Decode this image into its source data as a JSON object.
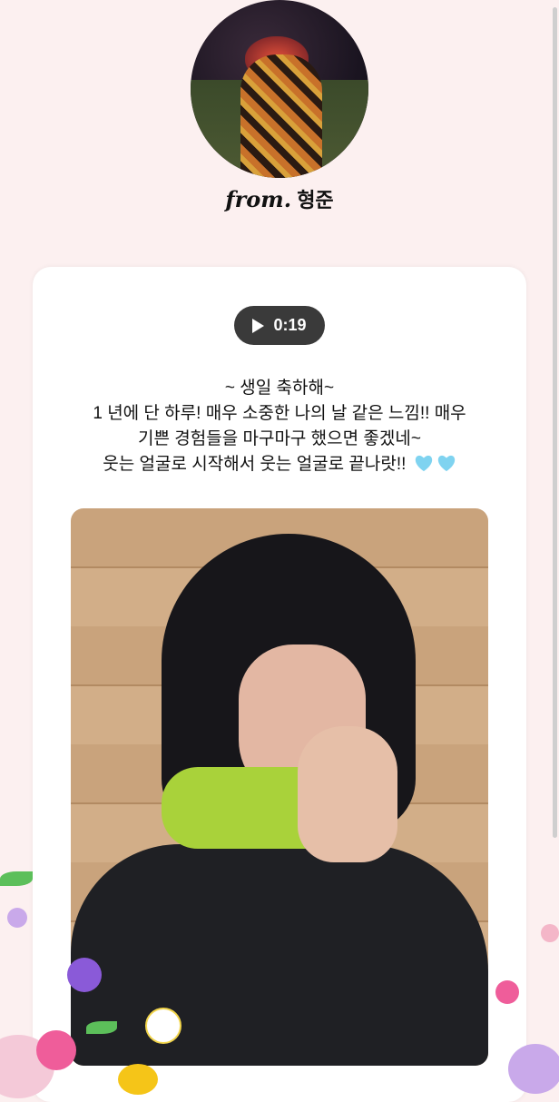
{
  "header": {
    "from_prefix": "from.",
    "sender_name": "형준"
  },
  "audio": {
    "duration": "0:19",
    "play_icon": "play-icon"
  },
  "message": {
    "lines": [
      "~ 생일 축하해~",
      "1 년에 단 하루! 매우 소중한 나의 날 같은 느낌!! 매우",
      "기쁜 경험들을 마구마구 했으면 좋겠네~",
      "웃는 얼굴로 시작해서 웃는 얼굴로 끝나랏!!"
    ],
    "emoji": "light-blue-heart-icon",
    "heart_color": "#7fd3f0"
  },
  "colors": {
    "background": "#fcf0f0",
    "card": "#ffffff",
    "audio_pill": "#3a3a3a"
  }
}
